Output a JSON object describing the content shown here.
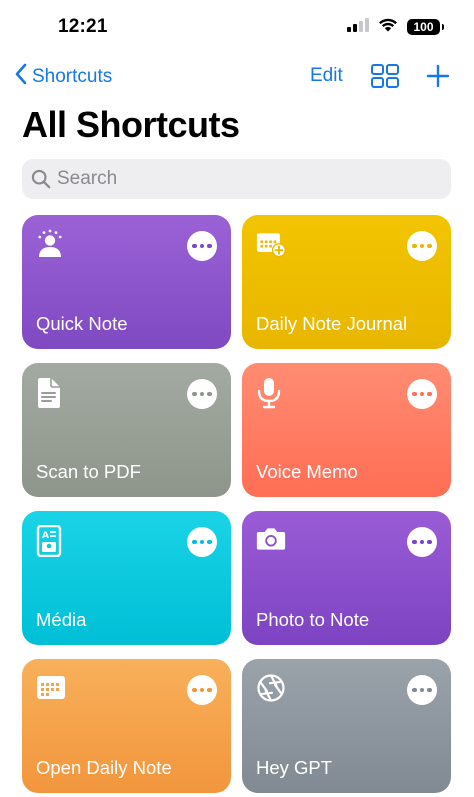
{
  "status_bar": {
    "time": "12:21",
    "battery": "100"
  },
  "nav": {
    "back_label": "Shortcuts",
    "edit_label": "Edit"
  },
  "page": {
    "title": "All Shortcuts"
  },
  "search": {
    "placeholder": "Search"
  },
  "shortcuts": [
    {
      "label": "Quick Note",
      "icon": "person-icon",
      "color_top": "#9b62d6",
      "color_bottom": "#7f49c2"
    },
    {
      "label": "Daily Note Journal",
      "icon": "calendar-plus-icon",
      "color_top": "#f2c400",
      "color_bottom": "#e8b600"
    },
    {
      "label": "Scan to PDF",
      "icon": "document-icon",
      "color_top": "#a3aaa1",
      "color_bottom": "#8e968c"
    },
    {
      "label": "Voice Memo",
      "icon": "microphone-icon",
      "color_top": "#ff8c72",
      "color_bottom": "#ff6e55"
    },
    {
      "label": "Média",
      "icon": "contact-card-icon",
      "color_top": "#1ad3e6",
      "color_bottom": "#00bfd6"
    },
    {
      "label": "Photo to Note",
      "icon": "camera-icon",
      "color_top": "#9a5cd6",
      "color_bottom": "#7c43c2"
    },
    {
      "label": "Open Daily Note",
      "icon": "calendar-icon",
      "color_top": "#f8b05a",
      "color_bottom": "#f2963d"
    },
    {
      "label": "Hey GPT",
      "icon": "aperture-icon",
      "color_top": "#9aa2aa",
      "color_bottom": "#818a93"
    }
  ],
  "colors": {
    "accent": "#1677e6"
  }
}
